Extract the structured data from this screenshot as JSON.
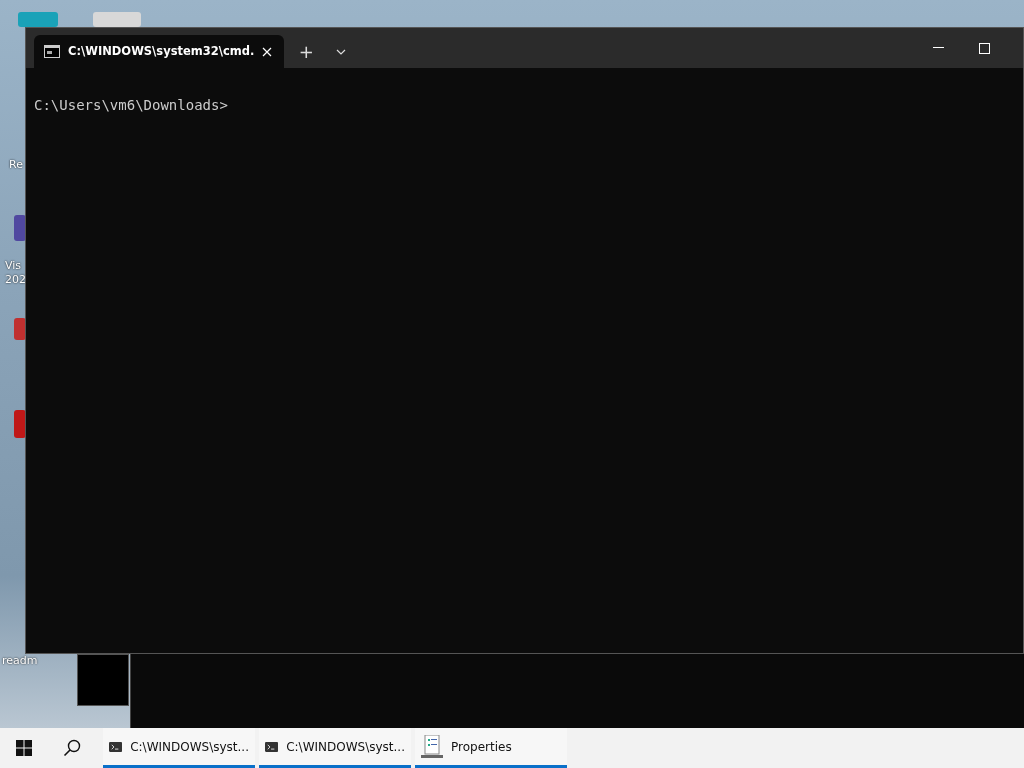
{
  "desktop_icons": [
    {
      "label": "Re"
    },
    {
      "label": "Vis"
    },
    {
      "label": "202"
    },
    {
      "label": "readm"
    }
  ],
  "window": {
    "tabs": [
      {
        "title": "C:\\WINDOWS\\system32\\cmd.",
        "selected": true
      }
    ],
    "new_tab": "+"
  },
  "terminal": {
    "lines": [
      "C:\\Users\\vm6\\Downloads>"
    ]
  },
  "taskbar": {
    "items": [
      {
        "kind": "terminal",
        "label": "C:\\WINDOWS\\syst..."
      },
      {
        "kind": "terminal",
        "label": "C:\\WINDOWS\\syst..."
      },
      {
        "kind": "properties",
        "label": "Properties"
      }
    ]
  }
}
